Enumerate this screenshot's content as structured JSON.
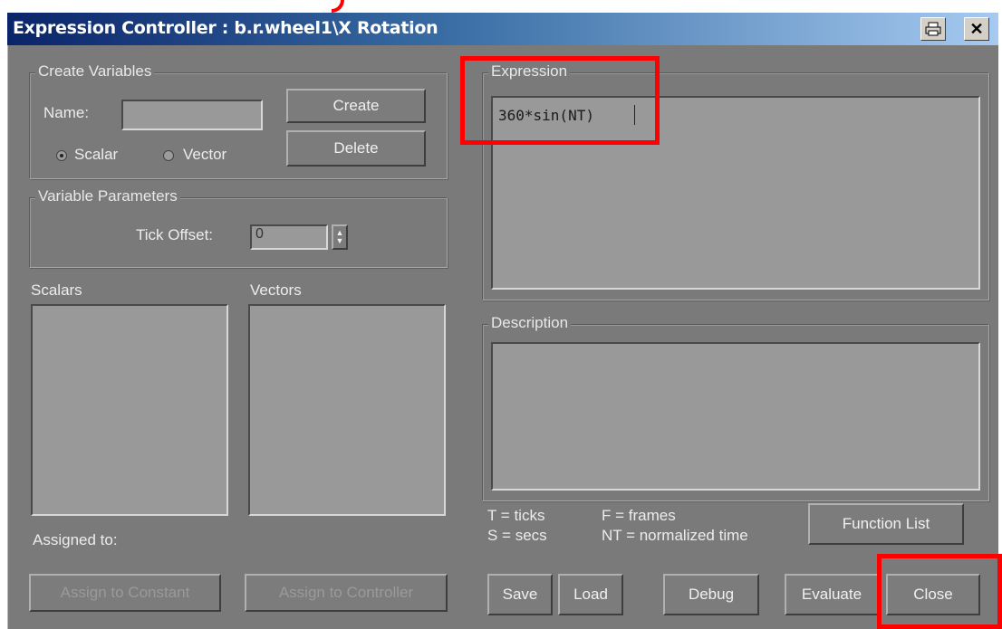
{
  "window": {
    "title": "Expression Controller : b.r.wheel1\\X Rotation"
  },
  "create_variables": {
    "legend": "Create Variables",
    "name_label": "Name:",
    "name_value": "",
    "create_label": "Create",
    "delete_label": "Delete",
    "scalar_label": "Scalar",
    "vector_label": "Vector",
    "selected_type": "Scalar"
  },
  "variable_parameters": {
    "legend": "Variable Parameters",
    "tick_offset_label": "Tick Offset:",
    "tick_offset_value": "0"
  },
  "lists": {
    "scalars_label": "Scalars",
    "vectors_label": "Vectors",
    "assigned_to_label": "Assigned to:",
    "assign_constant_label": "Assign to Constant",
    "assign_controller_label": "Assign to Controller"
  },
  "expression": {
    "legend": "Expression",
    "value": "360*sin(NT)"
  },
  "description": {
    "legend": "Description",
    "value": ""
  },
  "legend_help": {
    "t": "T = ticks",
    "s": "S = secs",
    "f": "F = frames",
    "nt": "NT = normalized time"
  },
  "buttons": {
    "function_list": "Function List",
    "save": "Save",
    "load": "Load",
    "debug": "Debug",
    "evaluate": "Evaluate",
    "close": "Close"
  },
  "colors": {
    "panel": "#7a7a7a",
    "highlight": "#ff0000"
  }
}
